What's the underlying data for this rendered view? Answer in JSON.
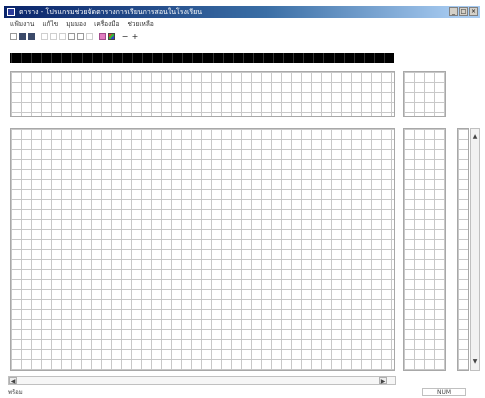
{
  "window": {
    "title": "ตาราง - โปรแกรมช่วยจัดตารางการเรียนการสอนในโรงเรียน",
    "buttons": {
      "minimize": "_",
      "maximize": "□",
      "close": "×"
    }
  },
  "menubar": {
    "items": [
      {
        "label": "แฟ้มงาน"
      },
      {
        "label": "แก้ไข"
      },
      {
        "label": "มุมมอง"
      },
      {
        "label": "เครื่องมือ"
      },
      {
        "label": "ช่วยเหลือ"
      }
    ]
  },
  "toolbar": {
    "buttons": [
      {
        "icon": "new-document-icon"
      },
      {
        "icon": "open-folder-icon"
      },
      {
        "icon": "save-icon"
      },
      {
        "icon": "cut-icon"
      },
      {
        "icon": "copy-icon"
      },
      {
        "icon": "paste-icon"
      },
      {
        "icon": "find-icon"
      },
      {
        "icon": "print-icon"
      },
      {
        "icon": "properties-icon"
      },
      {
        "icon": "calendar-icon"
      },
      {
        "icon": "palette-icon"
      }
    ],
    "zoom_out_label": "−",
    "zoom_in_label": "+"
  },
  "colors": {
    "title_bar": "#0a246a",
    "hour_bar": "#000000",
    "grid_lines": "#c8c8c8"
  },
  "statusbar": {
    "left_text": "พร้อม",
    "right_panel": "NUM"
  }
}
